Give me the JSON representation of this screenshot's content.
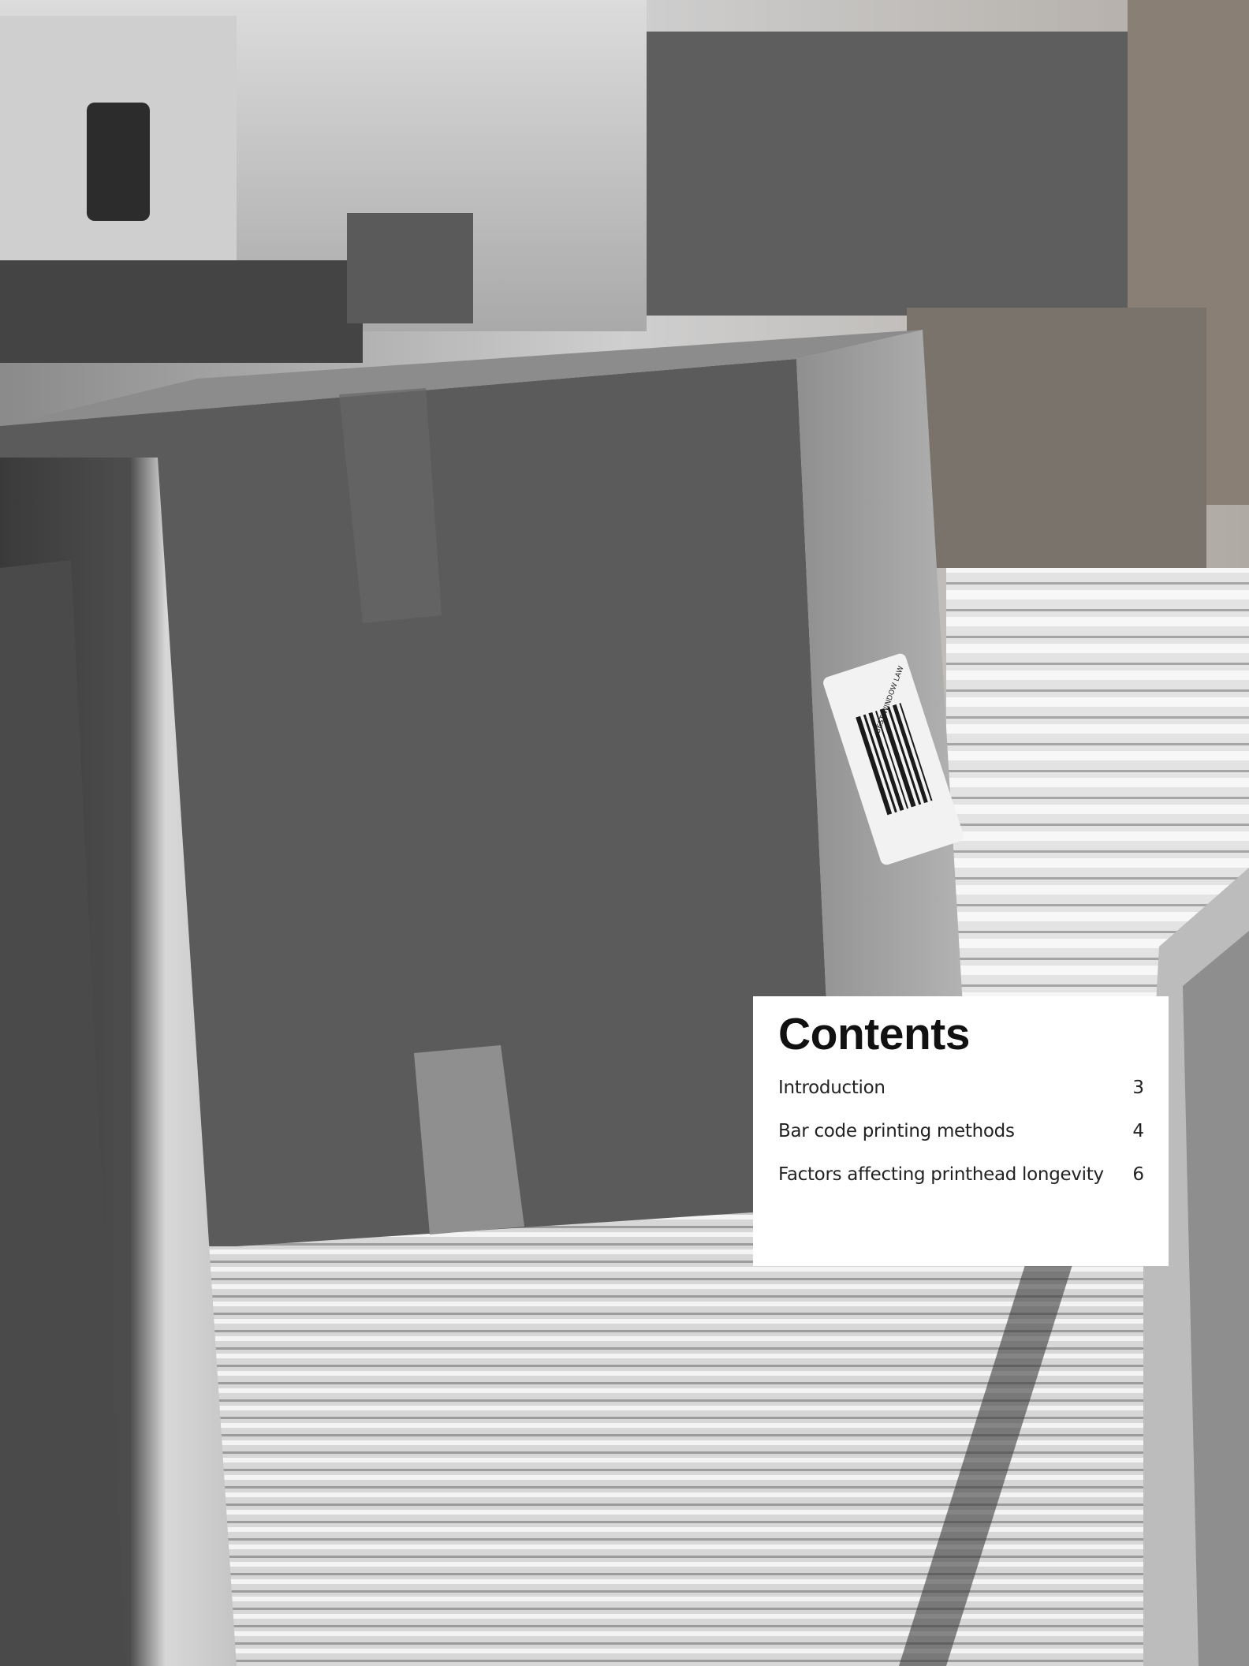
{
  "contents": {
    "title": "Contents",
    "entries": [
      {
        "label": "Introduction",
        "page": "3"
      },
      {
        "label": "Bar code printing methods",
        "page": "4"
      },
      {
        "label": "Factors affecting printhead longevity",
        "page": "6"
      }
    ]
  },
  "photo": {
    "subject": "cardboard-box-on-conveyor",
    "label_text": [
      "BEST WINDOW LAW"
    ],
    "palette": {
      "background": "#d9d9d9",
      "box_front": "#5b5b5b",
      "box_side": "#9b9b9b",
      "conveyor": "#e6e6e6"
    }
  }
}
